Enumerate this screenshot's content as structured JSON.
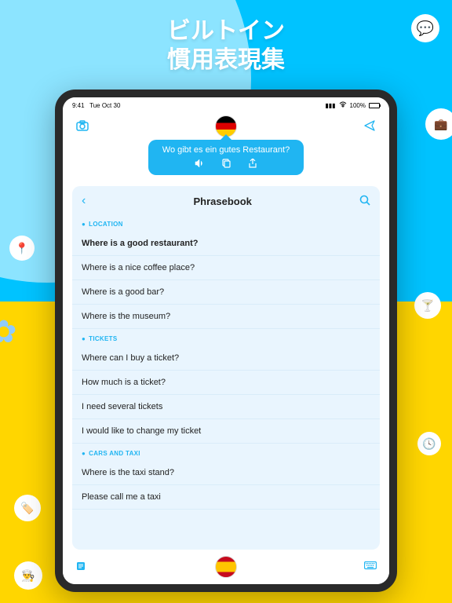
{
  "headline": {
    "line1": "ビルトイン",
    "line2": "慣用表現集"
  },
  "statusbar": {
    "time": "9:41",
    "date": "Tue Oct 30",
    "signal": ".ıl",
    "wifi": "wifi",
    "battery_pct": "100%"
  },
  "topbar": {
    "left_icon": "camera-icon",
    "flag": "germany",
    "right_icon": "plane-icon"
  },
  "translation_bubble": {
    "text": "Wo gibt es ein gutes Restaurant?",
    "actions": {
      "speak": "speaker-icon",
      "copy": "copy-icon",
      "share": "share-icon"
    }
  },
  "phrasebook": {
    "title": "Phrasebook",
    "sections": [
      {
        "label": "LOCATION",
        "icon": "pin-icon",
        "rows": [
          {
            "text": "Where is a good restaurant?",
            "selected": true
          },
          {
            "text": "Where is a nice coffee place?",
            "selected": false
          },
          {
            "text": "Where is a good bar?",
            "selected": false
          },
          {
            "text": "Where is the museum?",
            "selected": false
          }
        ]
      },
      {
        "label": "TICKETS",
        "icon": "ticket-icon",
        "rows": [
          {
            "text": "Where can I buy a ticket?",
            "selected": false
          },
          {
            "text": "How much is a ticket?",
            "selected": false
          },
          {
            "text": "I need several tickets",
            "selected": false
          },
          {
            "text": "I would like to change my ticket",
            "selected": false
          }
        ]
      },
      {
        "label": "CARS AND TAXI",
        "icon": "car-icon",
        "rows": [
          {
            "text": "Where is the taxi stand?",
            "selected": false
          },
          {
            "text": "Please call me a taxi",
            "selected": false
          }
        ]
      }
    ]
  },
  "bottombar": {
    "left_icon": "note-icon",
    "flag": "spain",
    "right_icon": "keyboard-icon"
  }
}
